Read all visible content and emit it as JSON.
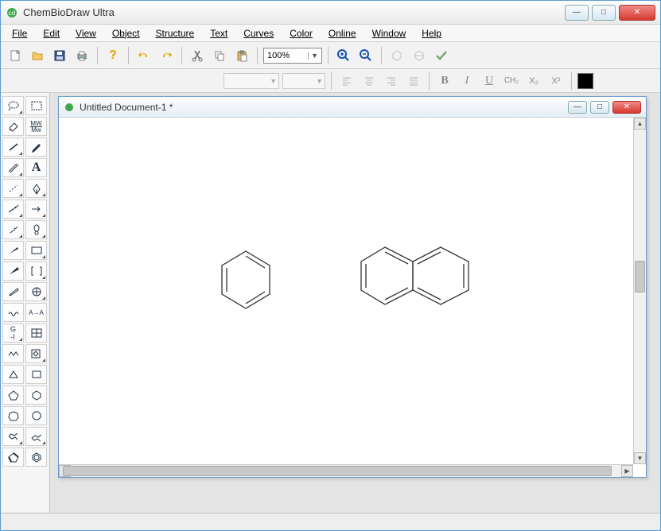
{
  "app": {
    "title": "ChemBioDraw Ultra"
  },
  "menu": {
    "file": "File",
    "edit": "Edit",
    "view": "View",
    "object": "Object",
    "structure": "Structure",
    "text": "Text",
    "curves": "Curves",
    "color": "Color",
    "online": "Online",
    "window": "Window",
    "help": "Help"
  },
  "toolbar": {
    "zoom_value": "100%",
    "icons": {
      "new": "new-file-icon",
      "open": "open-folder-icon",
      "save": "save-icon",
      "print": "print-icon",
      "help": "help-icon",
      "undo": "undo-icon",
      "redo": "redo-icon",
      "cut": "cut-icon",
      "copy": "copy-icon",
      "paste": "paste-icon",
      "zoom_in": "zoom-in-icon",
      "zoom_out": "zoom-out-icon",
      "clean": "clean-structure-icon",
      "analyze": "analyze-icon",
      "check": "check-icon"
    }
  },
  "format_bar": {
    "bold": "B",
    "italic": "I",
    "underline": "U",
    "formula": "CH₂",
    "subscript": "X₂",
    "superscript": "X²"
  },
  "document": {
    "title": "Untitled Document-1 *"
  },
  "structures": {
    "left": "benzene",
    "right": "naphthalene"
  }
}
